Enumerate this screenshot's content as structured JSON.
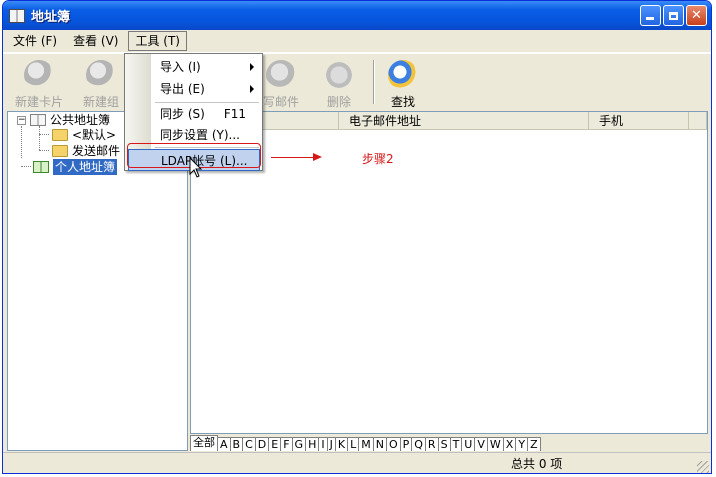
{
  "window": {
    "title": "地址簿"
  },
  "menubar": {
    "items": [
      "文件 (F)",
      "查看 (V)",
      "工具 (T)"
    ]
  },
  "toolbar": {
    "buttons": [
      "新建卡片",
      "新建组",
      "写邮件",
      "删除",
      "查找"
    ]
  },
  "tools_menu": {
    "items": [
      {
        "label": "导入 (I)",
        "submenu": true
      },
      {
        "label": "导出 (E)",
        "submenu": true
      },
      {
        "label": "同步 (S)",
        "shortcut": "F11"
      },
      {
        "label": "同步设置 (Y)..."
      },
      {
        "label": "LDAP帐号 (L)..."
      }
    ]
  },
  "tree": {
    "public": "公共地址簿",
    "default": "<默认>",
    "sent": "发送邮件",
    "personal": "个人地址簿"
  },
  "list": {
    "columns": [
      "电子邮件地址",
      "手机"
    ]
  },
  "alpha_tabs": [
    "全部",
    "A",
    "B",
    "C",
    "D",
    "E",
    "F",
    "G",
    "H",
    "I",
    "J",
    "K",
    "L",
    "M",
    "N",
    "O",
    "P",
    "Q",
    "R",
    "S",
    "T",
    "U",
    "V",
    "W",
    "X",
    "Y",
    "Z"
  ],
  "status": {
    "total": "总共 0 项"
  },
  "annotation": {
    "step": "步骤2"
  },
  "colors": {
    "annotation": "#d81818",
    "selection": "#316ac5",
    "titlebar": "#0655dc"
  }
}
